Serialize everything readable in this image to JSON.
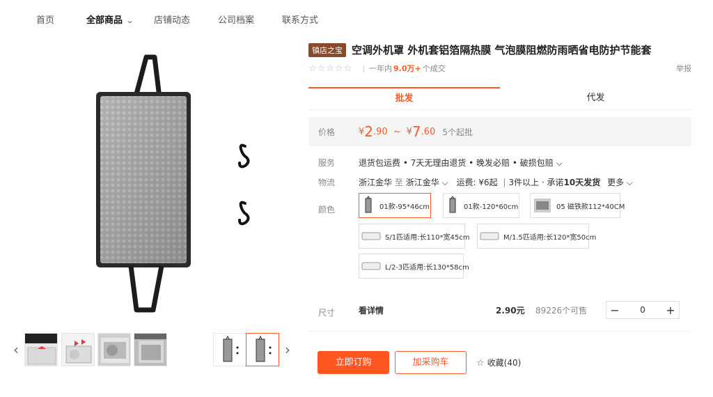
{
  "nav": {
    "home": "首页",
    "all_products": "全部商品",
    "store_news": "店铺动态",
    "company_profile": "公司档案",
    "contact": "联系方式"
  },
  "product": {
    "badge": "镇店之宝",
    "title": "空调外机罩 外机套铝箔隔热膜 气泡膜阻燃防雨晒省电防护节能套",
    "rating_period": "一年内",
    "sold_count": "9.0万+",
    "sold_suffix": "个成交",
    "report": "举报"
  },
  "tabs": [
    "批发",
    "代发"
  ],
  "price": {
    "label": "价格",
    "yen": "¥",
    "low_int": "2",
    "low_dec": ".90",
    "tilde": "~",
    "high_int": "7",
    "high_dec": ".60",
    "moq": "5个起批"
  },
  "service": {
    "label": "服务",
    "text": "退货包运费 • 7天无理由退货 • 晚发必赔 • 破损包赔 ⌵"
  },
  "logistics": {
    "label": "物流",
    "origin": "浙江金华",
    "to": "至",
    "dest": "浙江金华 ⌵",
    "fee_label": "运费:",
    "fee": "¥6起",
    "rule_pipe": "|",
    "rule": "3件以上 · 承诺",
    "promise": "10天发货",
    "more": "更多 ⌵"
  },
  "color": {
    "label": "颜色",
    "variants": [
      "01款-95*46cm",
      "01款-120*60cm",
      "05 磁铁款112*40CM",
      "S/1匹适用:长110*宽45cm",
      "M/1.5匹适用:长120*宽50cm",
      "L/2-3匹适用:长130*58cm"
    ],
    "selected_index": 0
  },
  "size": {
    "label": "尺寸",
    "name": "看详情",
    "price": "2.90元",
    "stock": "89226个可售",
    "minus": "−",
    "qty": "0",
    "plus": "+"
  },
  "actions": {
    "buy_now": "立即订购",
    "add_cart": "加采购车",
    "favorite": "收藏(40)"
  },
  "colors": {
    "accent": "#ff5722",
    "badge": "#8a4a2a"
  }
}
